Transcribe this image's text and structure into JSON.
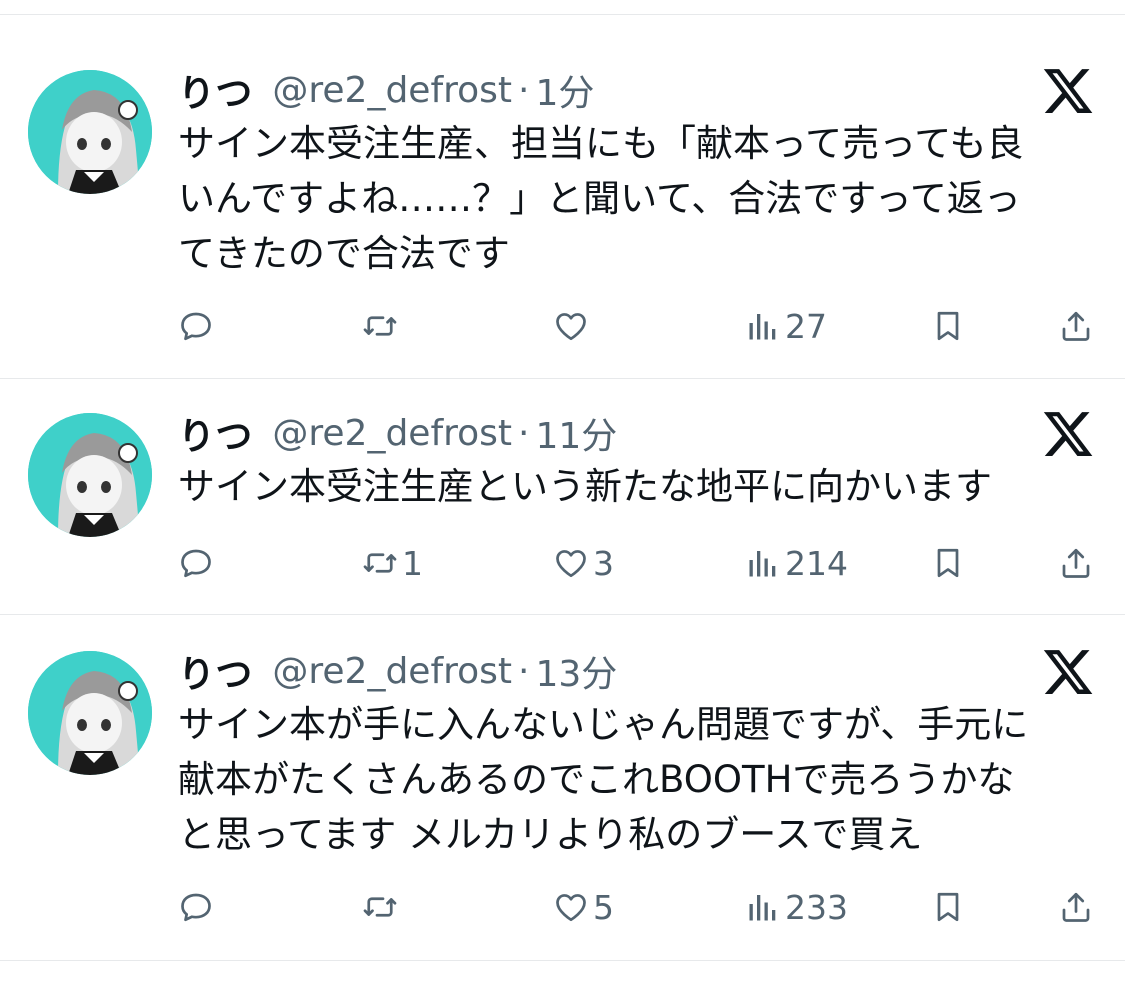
{
  "tweets": [
    {
      "name": "りつ",
      "handle": "@re2_defrost",
      "dot": "·",
      "time": "1分",
      "lines": [
        "サイン本受注生産、担当にも「献本って売っても良",
        "いんですよね……？」と聞いて、合法ですって返っ",
        "てきたので合法です"
      ],
      "replies": "",
      "retweets": "",
      "likes": "",
      "views": "27"
    },
    {
      "name": "りつ",
      "handle": "@re2_defrost",
      "dot": "·",
      "time": "11分",
      "lines": [
        "サイン本受注生産という新たな地平に向かいます"
      ],
      "replies": "",
      "retweets": "1",
      "likes": "3",
      "views": "214"
    },
    {
      "name": "りつ",
      "handle": "@re2_defrost",
      "dot": "·",
      "time": "13分",
      "lines": [
        "サイン本が手に入んないじゃん問題ですが、手元に",
        "献本がたくさんあるのでこれBOOTHで売ろうかな",
        "と思ってます メルカリより私のブースで買え"
      ],
      "replies": "",
      "retweets": "",
      "likes": "5",
      "views": "233"
    }
  ],
  "icons": {
    "avatar": "anime-girl-avatar",
    "platform": "x-logo-icon",
    "reply": "reply-icon",
    "retweet": "retweet-icon",
    "like": "heart-icon",
    "views": "views-chart-icon",
    "bookmark": "bookmark-icon",
    "share": "share-icon"
  },
  "colors": {
    "text": "#0f1419",
    "secondary": "#536471",
    "divider": "#e7e9eb",
    "avatar_bg": "#3fd0c9"
  }
}
